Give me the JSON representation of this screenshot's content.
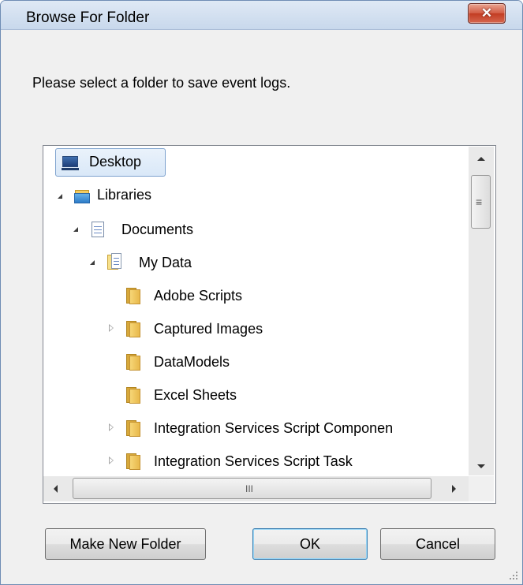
{
  "window": {
    "title": "Browse For Folder",
    "close_glyph": "✕"
  },
  "prompt": "Please select a folder to save event logs.",
  "tree": {
    "selected": "Desktop",
    "nodes": [
      {
        "label": "Desktop",
        "icon": "desktop-icon",
        "expander": "none"
      },
      {
        "label": "Libraries",
        "icon": "libraries-icon",
        "expander": "expanded"
      },
      {
        "label": "Documents",
        "icon": "documents-icon",
        "expander": "expanded"
      },
      {
        "label": "My Data",
        "icon": "mydata-folder-icon",
        "expander": "expanded"
      },
      {
        "label": "Adobe Scripts",
        "icon": "folder-icon",
        "expander": "none"
      },
      {
        "label": "Captured Images",
        "icon": "folder-icon",
        "expander": "collapsed"
      },
      {
        "label": "DataModels",
        "icon": "folder-icon",
        "expander": "none"
      },
      {
        "label": "Excel Sheets",
        "icon": "folder-icon",
        "expander": "none"
      },
      {
        "label": "Integration Services Script Componen",
        "icon": "folder-icon",
        "expander": "collapsed"
      },
      {
        "label": "Integration Services Script Task",
        "icon": "folder-icon",
        "expander": "collapsed"
      }
    ]
  },
  "scrollbars": {
    "vertical_grip": "≡",
    "horizontal_grip": "III"
  },
  "buttons": {
    "make_new_folder": "Make New Folder",
    "ok": "OK",
    "cancel": "Cancel"
  },
  "colors": {
    "selection_border": "#7da2ce",
    "close_button": "#c23c22",
    "titlebar": "#c8d8ec"
  }
}
